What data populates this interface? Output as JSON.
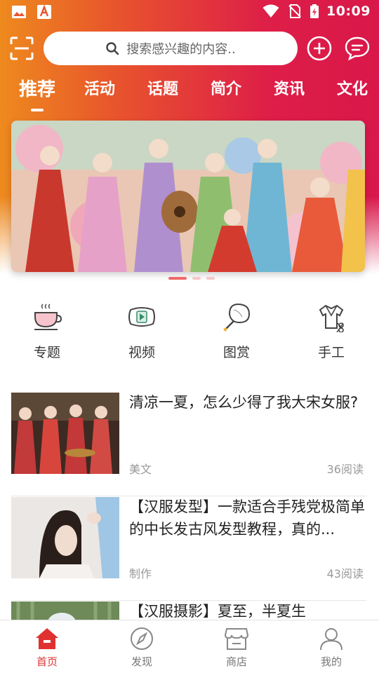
{
  "status_bar": {
    "time": "10:09",
    "left_icons": [
      "image-icon",
      "app-a-icon"
    ],
    "right_icons": [
      "wifi-icon",
      "no-sim-icon",
      "battery-charging-icon"
    ]
  },
  "header": {
    "search_placeholder": "搜索感兴趣的内容..",
    "icons": [
      "scan-icon",
      "search-icon",
      "plus-circle-icon",
      "message-icon"
    ]
  },
  "tabs": [
    {
      "label": "推荐",
      "active": true
    },
    {
      "label": "活动",
      "active": false
    },
    {
      "label": "话题",
      "active": false
    },
    {
      "label": "简介",
      "active": false
    },
    {
      "label": "资讯",
      "active": false
    },
    {
      "label": "文化",
      "active": false
    }
  ],
  "banner": {
    "carousel_count": 3,
    "active_index": 0
  },
  "categories": [
    {
      "label": "专题",
      "icon": "tea-cup-icon"
    },
    {
      "label": "视频",
      "icon": "video-play-icon"
    },
    {
      "label": "图赏",
      "icon": "fan-icon"
    },
    {
      "label": "手工",
      "icon": "sewing-icon"
    }
  ],
  "articles": [
    {
      "title": "清凉一夏，怎么少得了我大宋女服?",
      "category": "美文",
      "reads": "36阅读"
    },
    {
      "title": "【汉服发型】一款适合手残党极简单的中长发古风发型教程，真的...",
      "category": "制作",
      "reads": "43阅读"
    },
    {
      "title": "【汉服摄影】夏至，半夏生",
      "category": "",
      "reads": ""
    }
  ],
  "bottom_nav": [
    {
      "label": "首页",
      "icon": "home-icon",
      "active": true
    },
    {
      "label": "发现",
      "icon": "compass-icon",
      "active": false
    },
    {
      "label": "商店",
      "icon": "shop-icon",
      "active": false
    },
    {
      "label": "我的",
      "icon": "user-icon",
      "active": false
    }
  ],
  "colors": {
    "accent": "#e03131",
    "header_gradient_start": "#ee8a1e",
    "header_gradient_end": "#d9174a"
  }
}
